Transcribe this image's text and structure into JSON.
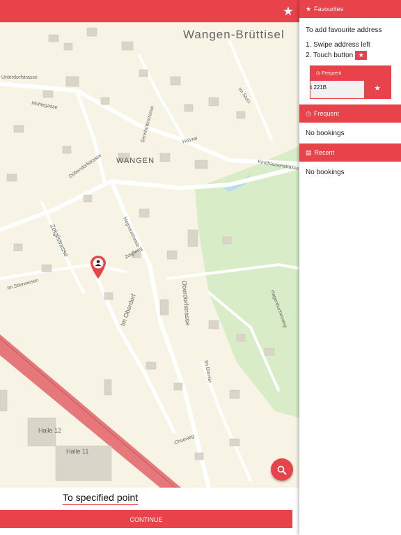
{
  "map": {
    "town_labels": [
      "Wangen-Brüttisel",
      "WANGEN"
    ],
    "street_labels": [
      "Unterdorfstrasse",
      "Mühlegasse",
      "Hegnaustrasse",
      "Im Oberdorf",
      "Zelglistrasse",
      "Kindhausenstrasse",
      "Holzrai",
      "Im Stutz",
      "Chüeweg",
      "Im Dörnler",
      "Hagenbuchenweg",
      "Zelglweg",
      "Im Stierwiesen",
      "Dübendorfstrasse",
      "Sennhüttestrasse",
      "Oberdorfstrasse"
    ],
    "place_labels": [
      "Halle 12",
      "Halle 11"
    ]
  },
  "toolbar": {
    "favourite_icon": "star-icon"
  },
  "bottom": {
    "destination": "To specified point",
    "continue_label": "CONTINUE"
  },
  "search_icon": "search-icon",
  "panel": {
    "favourites": {
      "title": "Favourites",
      "intro": "To add favourite address",
      "step1": "1. Swipe address left",
      "step2": "2. Touch button",
      "demo_header": "Frequent",
      "demo_address": "t 221B"
    },
    "frequent": {
      "title": "Frequent",
      "empty": "No bookings"
    },
    "recent": {
      "title": "Recent",
      "empty": "No bookings"
    }
  },
  "colors": {
    "accent": "#e8424a",
    "map_bg": "#f7f4e6",
    "green": "#d8ecc7",
    "water": "#b8dbf0"
  }
}
